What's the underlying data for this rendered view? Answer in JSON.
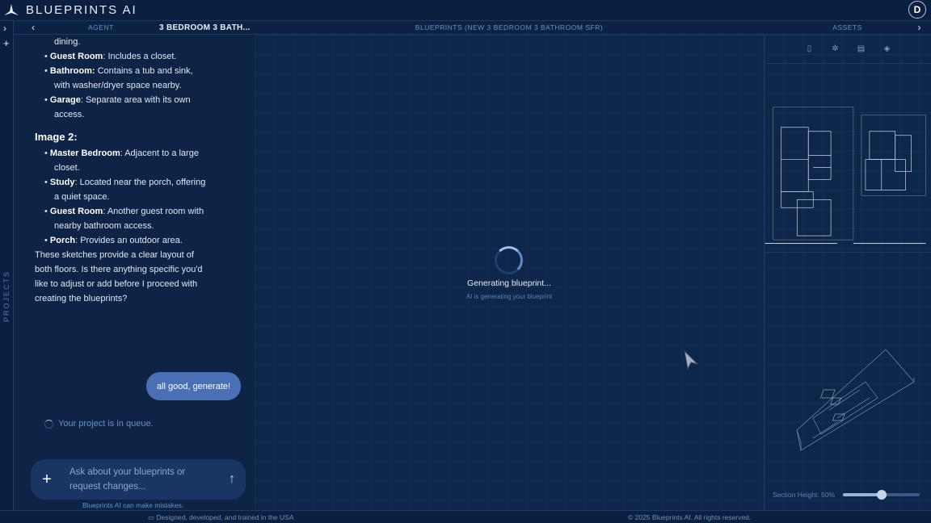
{
  "app": {
    "name": "BLUEPRINTS AI",
    "avatar_initial": "D"
  },
  "rail": {
    "projects_label": "PROJECTS"
  },
  "header": {
    "agent_label": "AGENT",
    "project_title": "3 BEDROOM 3 BATH...",
    "center_title": "BLUEPRINTS (NEW 3 BEDROOM 3 BATHROOM SFR)",
    "assets_label": "ASSETS"
  },
  "chat": {
    "lines": {
      "dining": "dining.",
      "guest_room_label": "Guest Room",
      "guest_room_text": ": Includes a closet.",
      "bathroom_label": "Bathroom:",
      "bathroom_text": " Contains a tub and sink, with washer/dryer space nearby.",
      "garage_label": "Garage",
      "garage_text": ": Separate area with its own access.",
      "image2_heading": "Image 2:",
      "master_label": "Master Bedroom",
      "master_text": ": Adjacent to a large closet.",
      "study_label": "Study",
      "study_text": ": Located near the porch, offering a quiet space.",
      "guest2_label": "Guest Room",
      "guest2_text": ": Another guest room with nearby bathroom access.",
      "porch_label": "Porch",
      "porch_text": ": Provides an outdoor area.",
      "closing": "These sketches provide a clear layout of both floors. Is there anything specific you'd like to adjust or add before I proceed with creating the blueprints?"
    },
    "user_message": "all good, generate!",
    "queue_status": "Your project is in queue.",
    "input_placeholder": "Ask about your blueprints or request changes...",
    "disclaimer": "Blueprints AI can make mistakes."
  },
  "center": {
    "generating_title": "Generating blueprint...",
    "generating_sub": "AI is generating your blueprint"
  },
  "assets": {
    "section_height_label": "Section Height: 50%",
    "section_height_value": 0.5
  },
  "footer": {
    "left": "Designed, developed, and trained in the USA",
    "right": "© 2025 Blueprints AI. All rights reserved."
  },
  "icons": [
    "logo-icon",
    "chevron-right-icon",
    "plus-icon",
    "chevron-left-icon",
    "document-icon",
    "gear-icon",
    "floorplan-icon",
    "cube-icon",
    "send-arrow-icon",
    "flag-icon",
    "cursor-icon"
  ]
}
